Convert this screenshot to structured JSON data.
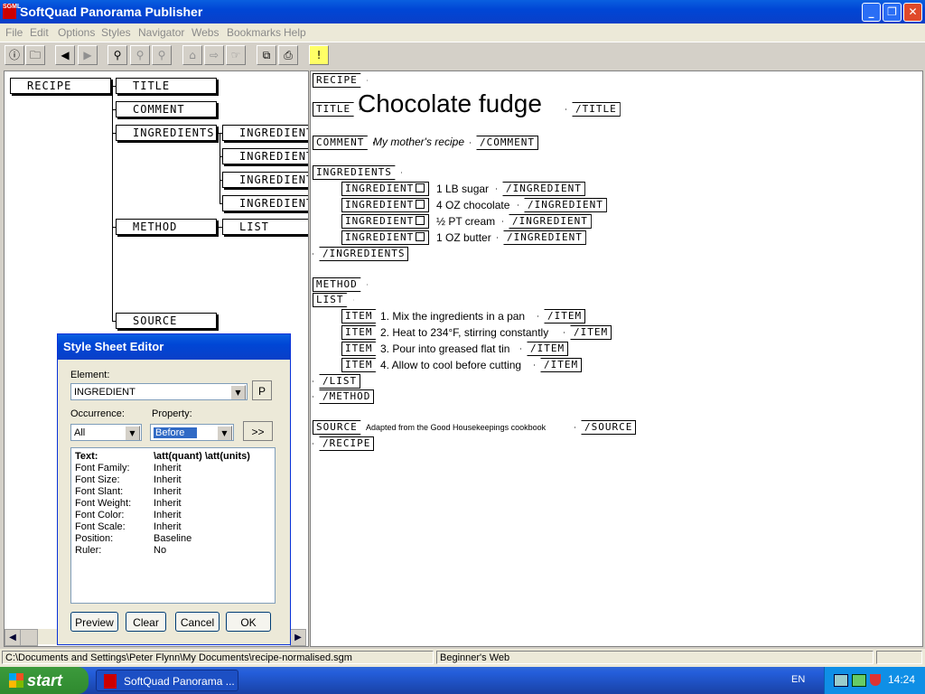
{
  "window": {
    "title": "SoftQuad Panorama Publisher",
    "app_icon_text": "SGML",
    "controls": {
      "minimize": "_",
      "restore": "❐",
      "close": "✕"
    }
  },
  "menu": [
    "File",
    "Edit",
    "Options",
    "Styles",
    "Navigator",
    "Webs",
    "Bookmarks",
    "Help"
  ],
  "toolbar": {
    "buttons": [
      {
        "icon": "info-icon",
        "glyph": "ⓘ"
      },
      {
        "icon": "open-folder-icon",
        "glyph": "🗀"
      },
      {
        "icon": "back-icon",
        "glyph": "◀"
      },
      {
        "icon": "forward-icon",
        "glyph": "▶"
      },
      {
        "icon": "binoculars-icon",
        "glyph": "⚲"
      },
      {
        "icon": "find-next-icon",
        "glyph": "⚲"
      },
      {
        "icon": "find-prev-icon",
        "glyph": "⚲"
      },
      {
        "icon": "link-icon",
        "glyph": "⌂"
      },
      {
        "icon": "link-out-icon",
        "glyph": "⇨"
      },
      {
        "icon": "hand-icon",
        "glyph": "☞"
      },
      {
        "icon": "copy-icon",
        "glyph": "⧉"
      },
      {
        "icon": "print-icon",
        "glyph": "⎙"
      },
      {
        "icon": "tip-icon",
        "glyph": "!"
      }
    ]
  },
  "tree": {
    "nodes": [
      {
        "id": "recipe",
        "label": "RECIPE"
      },
      {
        "id": "title",
        "label": "TITLE"
      },
      {
        "id": "comment",
        "label": "COMMENT"
      },
      {
        "id": "ingredients",
        "label": "INGREDIENTS"
      },
      {
        "id": "ingredient1",
        "label": "INGREDIENT"
      },
      {
        "id": "ingredient2",
        "label": "INGREDIENT"
      },
      {
        "id": "ingredient3",
        "label": "INGREDIENT"
      },
      {
        "id": "ingredient4",
        "label": "INGREDIENT"
      },
      {
        "id": "method",
        "label": "METHOD"
      },
      {
        "id": "list",
        "label": "LIST"
      },
      {
        "id": "source",
        "label": "SOURCE"
      }
    ]
  },
  "document": {
    "recipe_open": "RECIPE",
    "title_open": "TITLE",
    "title_text": "Chocolate fudge",
    "title_close": "/TITLE",
    "comment_open": "COMMENT",
    "comment_text": "My mother's recipe",
    "comment_close": "/COMMENT",
    "ingredients_open": "INGREDIENTS",
    "ingredient_open": "INGREDIENT",
    "ingredient_close": "/INGREDIENT",
    "ingredients": [
      "1 LB sugar",
      "4 OZ chocolate",
      "½ PT cream",
      "1 OZ butter"
    ],
    "ingredients_close": "/INGREDIENTS",
    "method_open": "METHOD",
    "list_open": "LIST",
    "item_open": "ITEM",
    "item_close": "/ITEM",
    "items": [
      "1. Mix the ingredients in a pan",
      "2. Heat to 234°F, stirring constantly",
      "3. Pour into greased flat tin",
      "4. Allow to cool before cutting"
    ],
    "list_close": "/LIST",
    "method_close": "/METHOD",
    "source_open": "SOURCE",
    "source_text": "Adapted from the Good Housekeepings cookbook",
    "source_close": "/SOURCE",
    "recipe_close": "/RECIPE"
  },
  "dialog": {
    "title": "Style Sheet Editor",
    "element_label": "Element:",
    "element_value": "INGREDIENT",
    "p_button": "P",
    "occurrence_label": "Occurrence:",
    "occurrence_value": "All",
    "property_label": "Property:",
    "property_value": "Before",
    "more_button": ">>",
    "properties": [
      {
        "key": "Text:",
        "value": "\\att(quant) \\att(units)",
        "bold": true
      },
      {
        "key": "Font Family:",
        "value": "Inherit"
      },
      {
        "key": "Font Size:",
        "value": "Inherit"
      },
      {
        "key": "Font Slant:",
        "value": "Inherit"
      },
      {
        "key": "Font Weight:",
        "value": "Inherit"
      },
      {
        "key": "Font Color:",
        "value": "Inherit"
      },
      {
        "key": "Font Scale:",
        "value": "Inherit"
      },
      {
        "key": "Position:",
        "value": "Baseline"
      },
      {
        "key": "Ruler:",
        "value": "No"
      }
    ],
    "buttons": {
      "preview": "Preview",
      "clear": "Clear",
      "cancel": "Cancel",
      "ok": "OK"
    }
  },
  "status": {
    "path": "C:\\Documents and Settings\\Peter Flynn\\My Documents\\recipe-normalised.sgm",
    "web": "Beginner's Web"
  },
  "taskbar": {
    "start": "start",
    "task": "SoftQuad Panorama ...",
    "lang": "EN",
    "clock": "14:24"
  },
  "colors": {
    "titlebar": "#0a5fe0",
    "taskbar": "#245edb",
    "start_green": "#3c9a3c",
    "tray": "#0f8fe6"
  }
}
